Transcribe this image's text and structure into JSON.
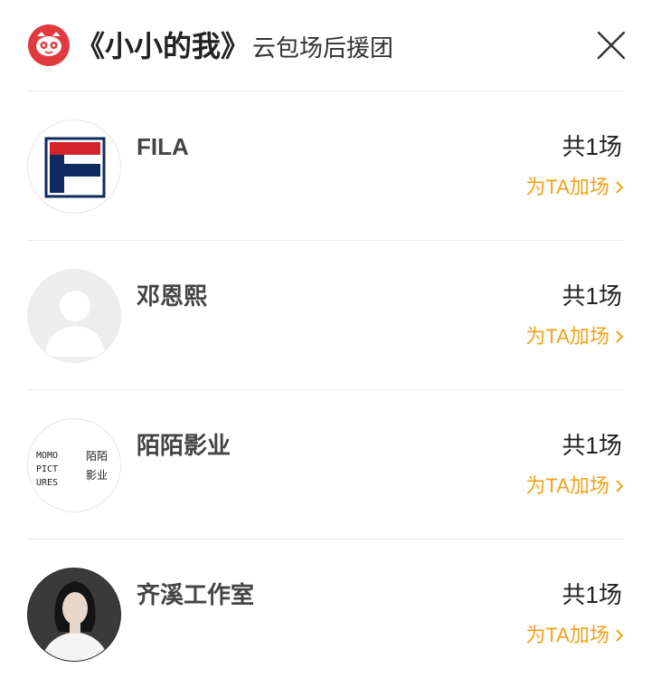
{
  "header": {
    "title": "《小小的我》",
    "subtitle": "云包场后援团"
  },
  "colors": {
    "brand_red": "#e0393e",
    "accent_orange": "#f0a21a",
    "divider": "#ececec"
  },
  "icons": {
    "logo": "cat-logo-icon",
    "close": "close-icon",
    "chevron": "chevron-right-icon"
  },
  "items": [
    {
      "name": "FILA",
      "count": "共1场",
      "action": "为TA加场",
      "avatar": "fila-logo"
    },
    {
      "name": "邓恩熙",
      "count": "共1场",
      "action": "为TA加场",
      "avatar": "default-person"
    },
    {
      "name": "陌陌影业",
      "count": "共1场",
      "action": "为TA加场",
      "avatar": "momo-pictures-logo",
      "avatar_text": {
        "latin": [
          "MOMO",
          "PICT",
          "URES"
        ],
        "cjk": [
          "陌陌",
          "影业"
        ]
      }
    },
    {
      "name": "齐溪工作室",
      "count": "共1场",
      "action": "为TA加场",
      "avatar": "person-photo"
    }
  ]
}
